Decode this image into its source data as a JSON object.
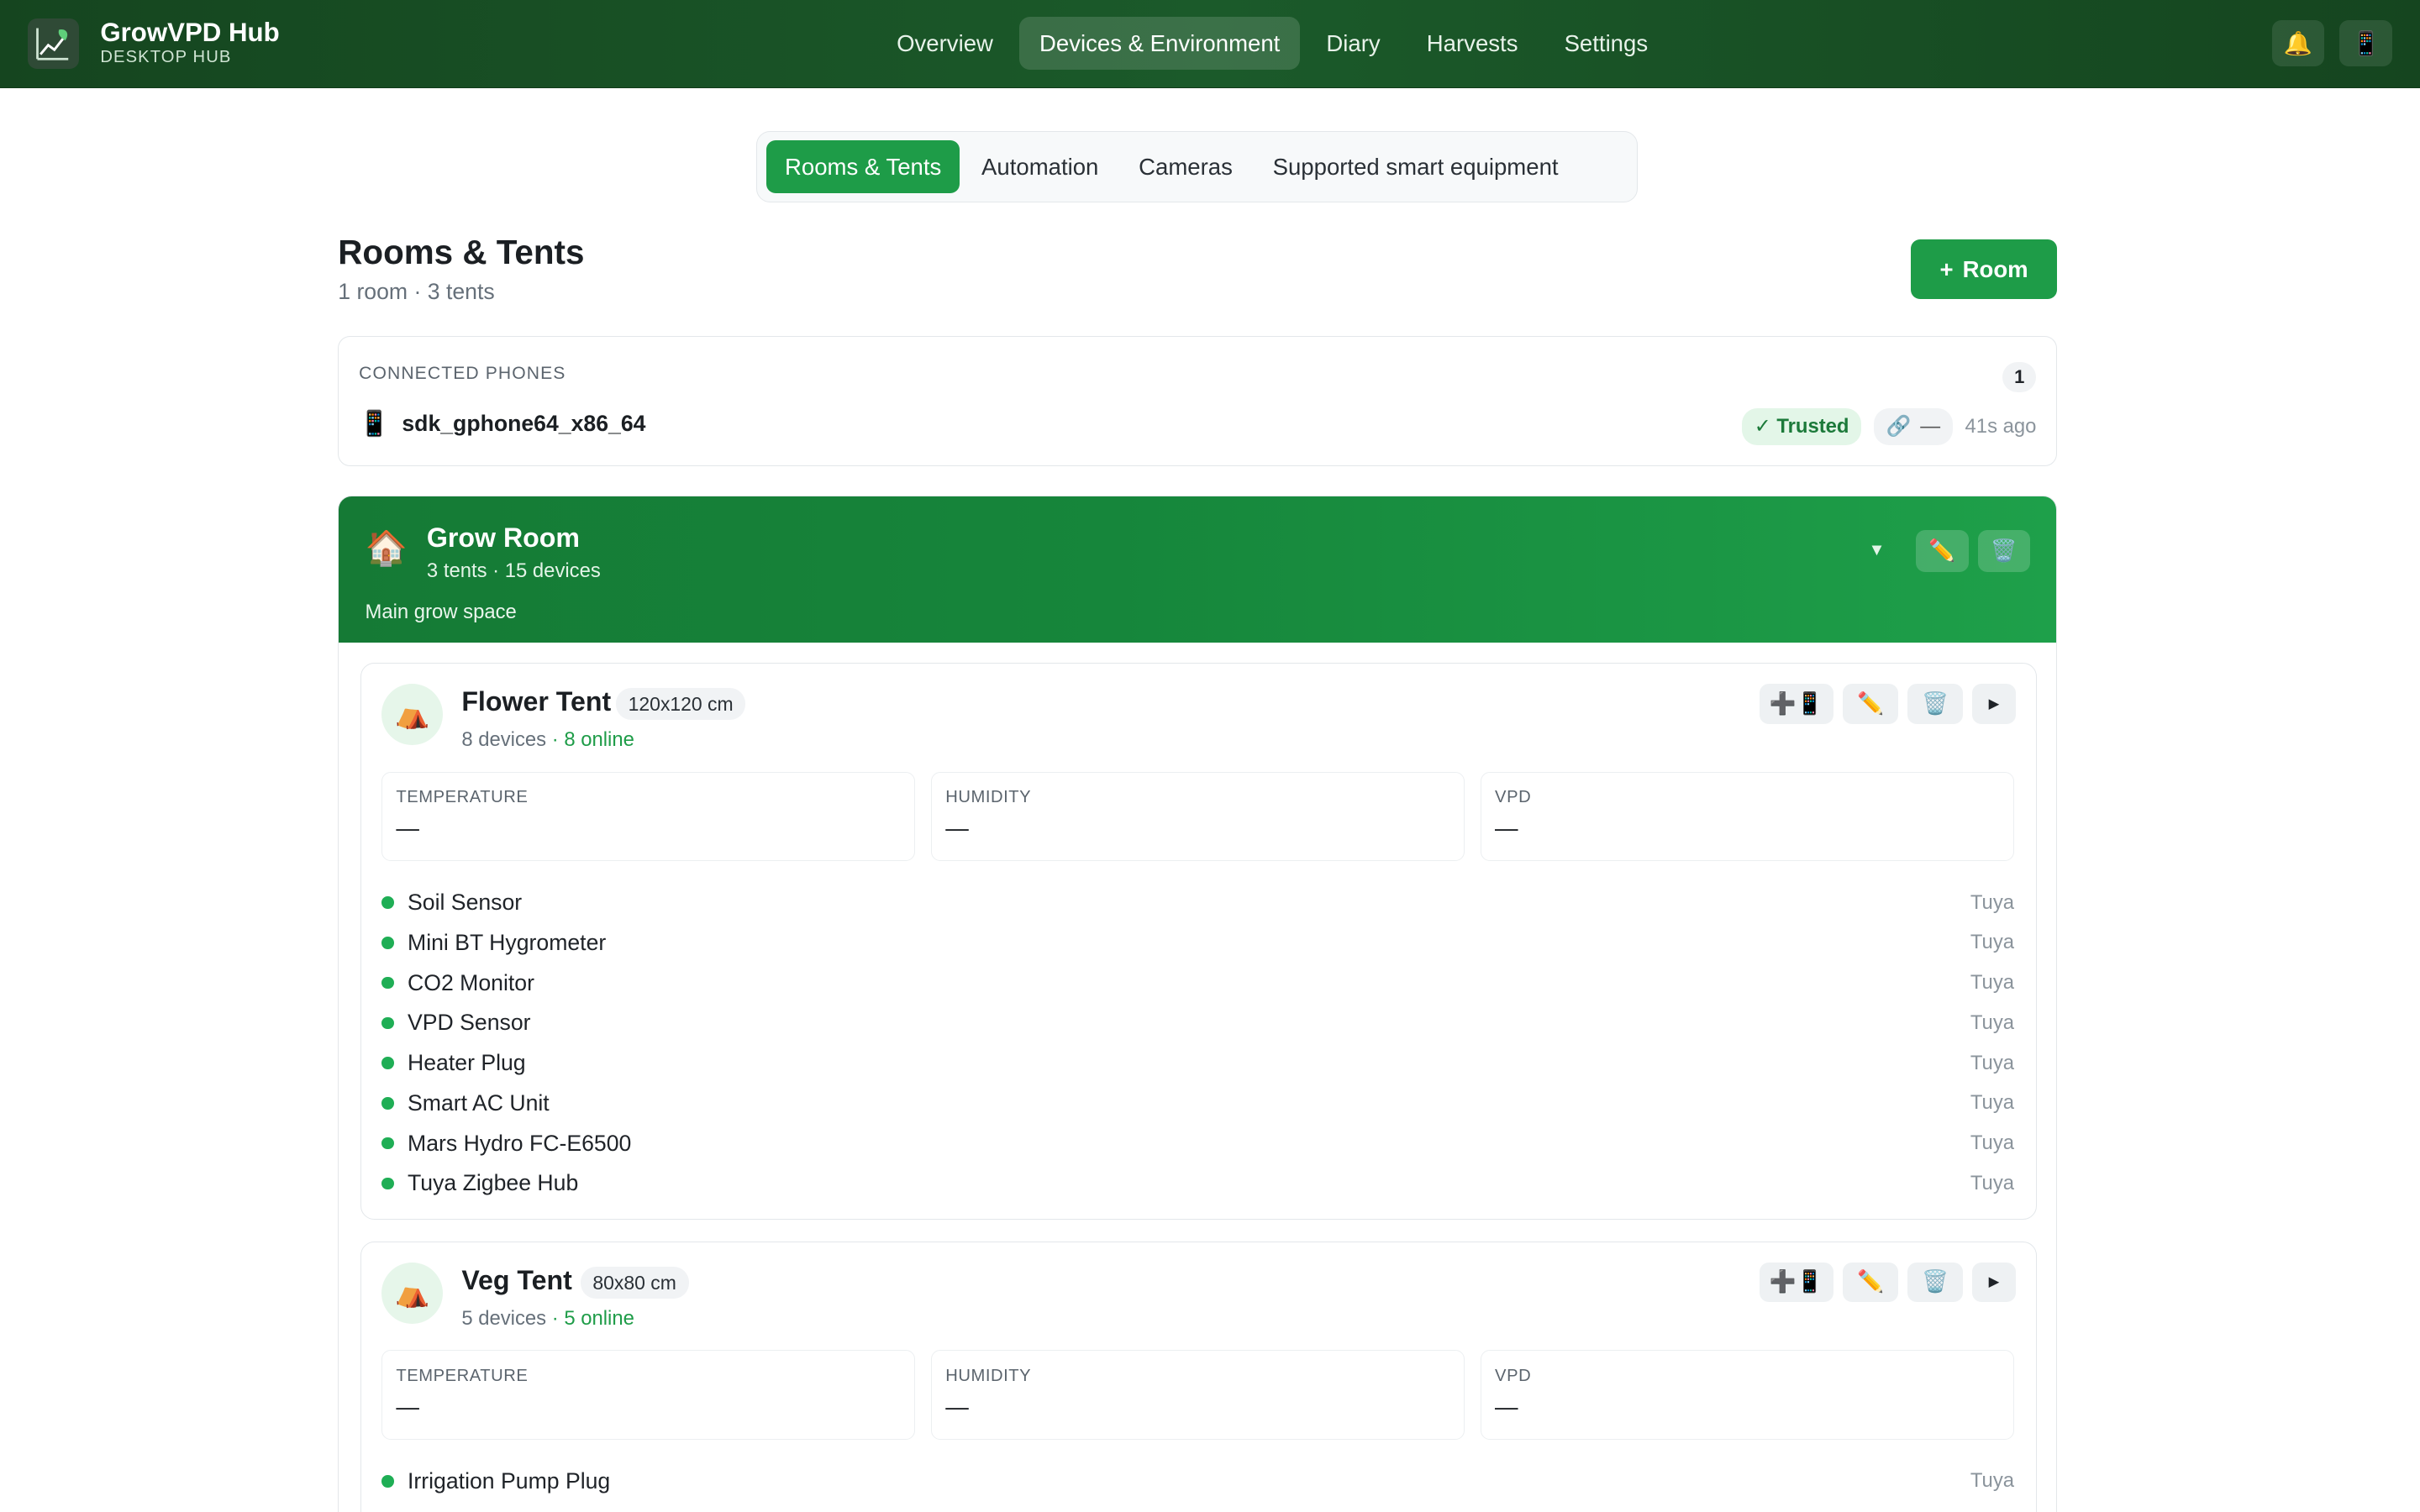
{
  "app": {
    "name": "GrowVPD Hub",
    "subtitle": "DESKTOP HUB"
  },
  "nav": {
    "items": [
      "Overview",
      "Devices & Environment",
      "Diary",
      "Harvests",
      "Settings"
    ],
    "active": "Devices & Environment"
  },
  "subtabs": {
    "items": [
      "Rooms & Tents",
      "Automation",
      "Cameras",
      "Supported smart equipment"
    ],
    "active": "Rooms & Tents"
  },
  "page": {
    "title": "Rooms & Tents",
    "subtitle": "1 room · 3 tents",
    "add_room_label": "Room",
    "add_room_icon": "+"
  },
  "phones": {
    "header": "CONNECTED PHONES",
    "count": "1",
    "device": {
      "name": "sdk_gphone64_x86_64",
      "status": "✓ Trusted",
      "link_value": "—",
      "last_seen": "41s ago"
    }
  },
  "room": {
    "name": "Grow Room",
    "meta": "3 tents  · 15 devices",
    "description": "Main grow space",
    "chevron": "▼"
  },
  "tents": [
    {
      "name": "Flower Tent",
      "size": "120x120 cm",
      "devices_count": "8 devices",
      "online": "· 8 online",
      "metrics": [
        {
          "label": "TEMPERATURE",
          "value": "—"
        },
        {
          "label": "HUMIDITY",
          "value": "—"
        },
        {
          "label": "VPD",
          "value": "—"
        }
      ],
      "devices": [
        {
          "name": "Soil Sensor",
          "brand": "Tuya"
        },
        {
          "name": "Mini BT Hygrometer",
          "brand": "Tuya"
        },
        {
          "name": "CO2 Monitor",
          "brand": "Tuya"
        },
        {
          "name": "VPD Sensor",
          "brand": "Tuya"
        },
        {
          "name": "Heater Plug",
          "brand": "Tuya"
        },
        {
          "name": "Smart AC Unit",
          "brand": "Tuya"
        },
        {
          "name": "Mars Hydro FC-E6500",
          "brand": "Tuya"
        },
        {
          "name": "Tuya Zigbee Hub",
          "brand": "Tuya"
        }
      ]
    },
    {
      "name": "Veg Tent",
      "size": "80x80 cm",
      "devices_count": "5 devices",
      "online": "· 5 online",
      "metrics": [
        {
          "label": "TEMPERATURE",
          "value": "—"
        },
        {
          "label": "HUMIDITY",
          "value": "—"
        },
        {
          "label": "VPD",
          "value": "—"
        }
      ],
      "devices": [
        {
          "name": "Irrigation Pump Plug",
          "brand": "Tuya"
        }
      ]
    }
  ],
  "icons": {
    "bell": "bell-icon",
    "phone": "phone-icon",
    "house": "house-icon",
    "tent": "tent-icon",
    "edit": "pencil-icon",
    "delete": "trash-icon",
    "add_device": "add-device-icon",
    "expand": "triangle-right-icon",
    "link": "link-icon"
  },
  "colors": {
    "brand_green": "#1e9c48",
    "header_dark": "#15451f",
    "online_dot": "#1fae55"
  }
}
